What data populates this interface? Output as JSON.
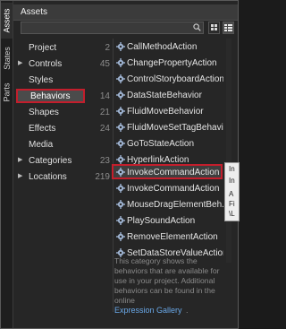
{
  "vertical_tabs": [
    "Assets",
    "States",
    "Parts"
  ],
  "panel": {
    "title": "Assets"
  },
  "search": {
    "placeholder": "",
    "value": ""
  },
  "categories": [
    {
      "label": "Project",
      "count": "2",
      "expandable": false
    },
    {
      "label": "Controls",
      "count": "45",
      "expandable": true
    },
    {
      "label": "Styles",
      "count": "",
      "expandable": false
    },
    {
      "label": "Behaviors",
      "count": "14",
      "expandable": false,
      "selected": true
    },
    {
      "label": "Shapes",
      "count": "21",
      "expandable": false
    },
    {
      "label": "Effects",
      "count": "24",
      "expandable": false
    },
    {
      "label": "Media",
      "count": "",
      "expandable": false
    },
    {
      "label": "Categories",
      "count": "23",
      "expandable": true
    },
    {
      "label": "Locations",
      "count": "219",
      "expandable": true
    }
  ],
  "behaviors": [
    "CallMethodAction",
    "ChangePropertyAction",
    "ControlStoryboardAction",
    "DataStateBehavior",
    "FluidMoveBehavior",
    "FluidMoveSetTagBehavi...",
    "GoToStateAction",
    "HyperlinkAction",
    "InvokeCommandAction",
    "InvokeCommandAction",
    "MouseDragElementBeh...",
    "PlaySoundAction",
    "RemoveElementAction",
    "SetDataStoreValueAction"
  ],
  "description": "This category shows the behaviors that are available for use in your project. Additional behaviors can be found in the online",
  "link_text": "Expression Gallery",
  "link_suffix": ".",
  "tooltip_lines": [
    "In",
    "In",
    "A",
    "Fi",
    "\\L"
  ],
  "colors": {
    "highlight_border": "#c31e2c",
    "link": "#6aa9e9",
    "background": "#262626"
  }
}
